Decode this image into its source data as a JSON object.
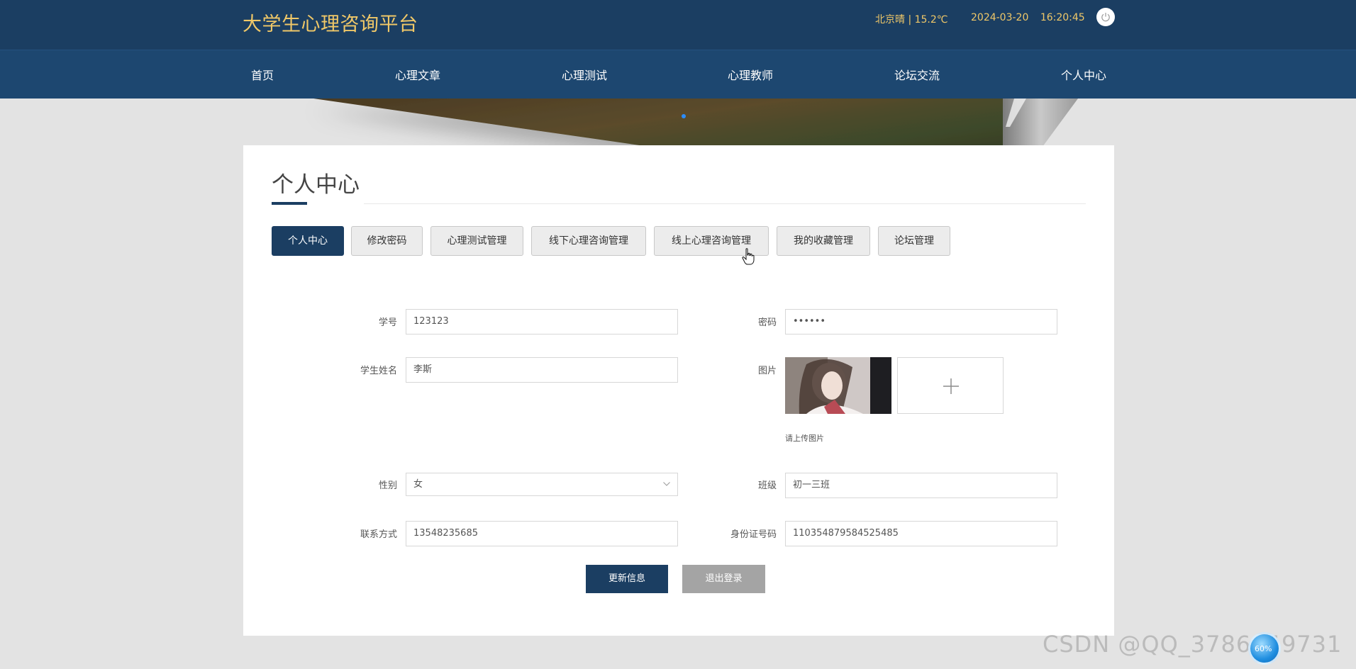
{
  "header": {
    "brand": "大学生心理咨询平台",
    "weather": "北京晴 | 15.2℃",
    "date": "2024-03-20",
    "time": "16:20:45",
    "power_icon": "power-icon"
  },
  "nav": {
    "items": [
      "首页",
      "心理文章",
      "心理测试",
      "心理教师",
      "论坛交流",
      "个人中心"
    ]
  },
  "page": {
    "title": "个人中心"
  },
  "tabs": {
    "items": [
      "个人中心",
      "修改密码",
      "心理测试管理",
      "线下心理咨询管理",
      "线上心理咨询管理",
      "我的收藏管理",
      "论坛管理"
    ],
    "active": "个人中心"
  },
  "form": {
    "student_no": {
      "label": "学号",
      "value": "123123"
    },
    "password": {
      "label": "密码",
      "value": "••••••"
    },
    "student_name": {
      "label": "学生姓名",
      "value": "李斯"
    },
    "photo": {
      "label": "图片",
      "hint": "请上传图片",
      "add_icon": "plus-icon"
    },
    "gender": {
      "label": "性别",
      "value": "女"
    },
    "class": {
      "label": "班级",
      "value": "初一三班"
    },
    "phone": {
      "label": "联系方式",
      "value": "13548235685"
    },
    "id_card": {
      "label": "身份证号码",
      "value": "110354879584525485"
    }
  },
  "actions": {
    "update": "更新信息",
    "logout": "退出登录"
  },
  "overlay": {
    "watermark": "CSDN @QQ_3786649731",
    "badge": "60%"
  },
  "colors": {
    "header_bg": "#1b3e62",
    "nav_bg": "#1d4770",
    "brand": "#f0c868",
    "accent": "#1b3e62"
  }
}
